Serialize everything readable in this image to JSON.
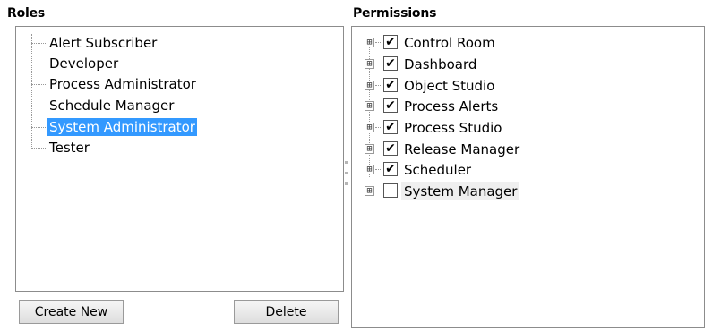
{
  "roles": {
    "title": "Roles",
    "items": [
      {
        "label": "Alert Subscriber",
        "selected": false
      },
      {
        "label": "Developer",
        "selected": false
      },
      {
        "label": "Process Administrator",
        "selected": false
      },
      {
        "label": "Schedule Manager",
        "selected": false
      },
      {
        "label": "System Administrator",
        "selected": true
      },
      {
        "label": "Tester",
        "selected": false
      }
    ],
    "create_label": "Create New",
    "delete_label": "Delete"
  },
  "permissions": {
    "title": "Permissions",
    "items": [
      {
        "label": "Control Room",
        "checked": true
      },
      {
        "label": "Dashboard",
        "checked": true
      },
      {
        "label": "Object Studio",
        "checked": true
      },
      {
        "label": "Process Alerts",
        "checked": true
      },
      {
        "label": "Process Studio",
        "checked": true
      },
      {
        "label": "Release Manager",
        "checked": true
      },
      {
        "label": "Scheduler",
        "checked": true
      },
      {
        "label": "System Manager",
        "checked": false
      }
    ],
    "expander_glyph": "⊞",
    "check_glyph": "✔"
  },
  "colors": {
    "selection": "#3399ff",
    "border": "#8c8c8c"
  }
}
